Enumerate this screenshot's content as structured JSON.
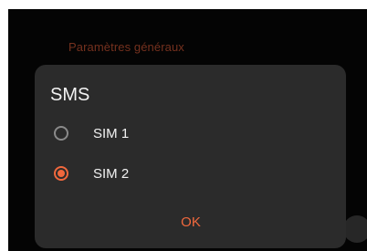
{
  "background": {
    "section_header": "Paramètres généraux"
  },
  "dialog": {
    "title": "SMS",
    "options": [
      {
        "label": "SIM 1",
        "selected": false
      },
      {
        "label": "SIM 2",
        "selected": true
      }
    ],
    "ok_label": "OK"
  },
  "colors": {
    "accent": "#f0683d",
    "dialog_bg": "#2b2b2b",
    "app_bg": "#050505",
    "header_text": "#8a3a24"
  }
}
